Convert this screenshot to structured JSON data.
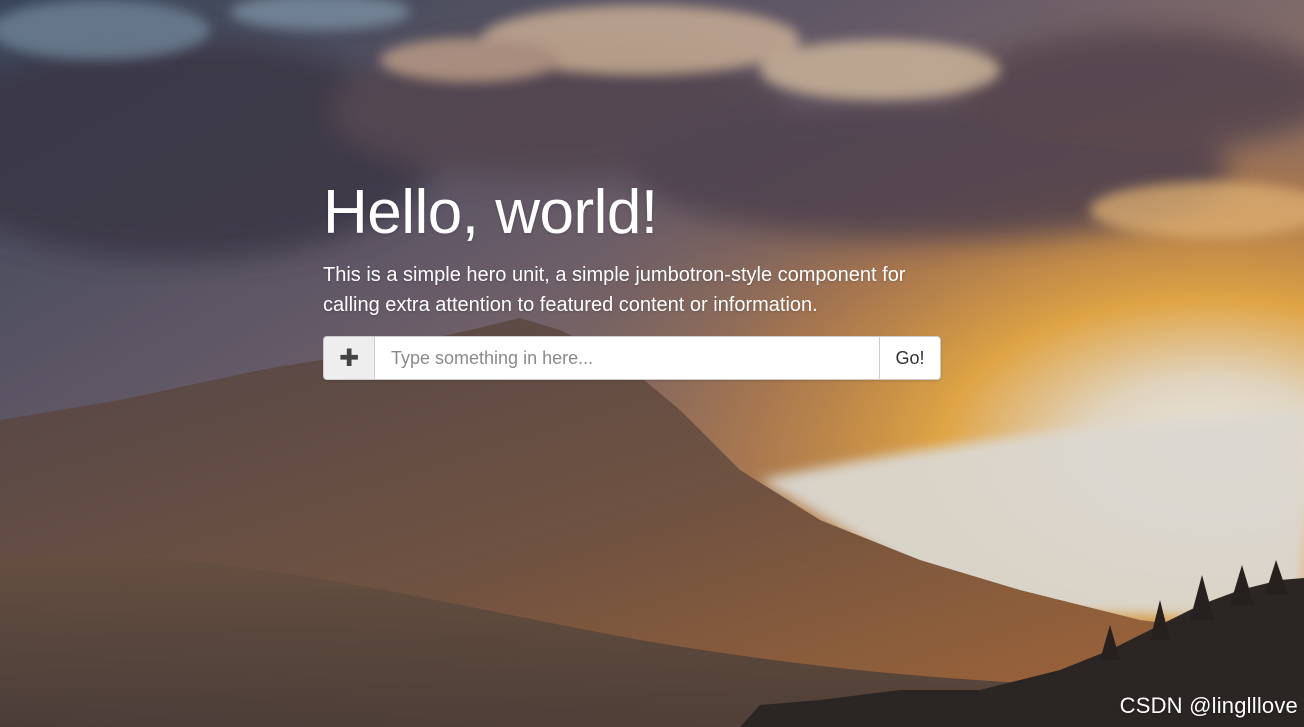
{
  "hero": {
    "title": "Hello, world!",
    "lead": "This is a simple hero unit, a simple jumbotron-style component for calling extra attention to featured content or information.",
    "background": "sunset-mountain-photo",
    "colors": {
      "sky_top": "#3d4f66",
      "cloud_dark": "#4e4554",
      "sun_glow": "#f6b041",
      "horizon_light": "#f1ede6",
      "mountain": "#6a5244"
    }
  },
  "search": {
    "addon_icon": "plus-icon",
    "addon_glyph": "✚",
    "placeholder": "Type something in here...",
    "value": "",
    "button_label": "Go!"
  },
  "watermark": {
    "text": "CSDN @linglllove"
  }
}
